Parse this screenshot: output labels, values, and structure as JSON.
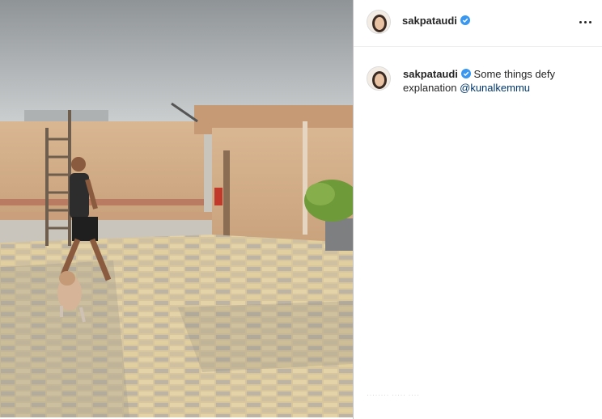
{
  "post": {
    "author": {
      "username": "sakpataudi",
      "verified": true,
      "avatar_icon": "profile-avatar"
    },
    "header": {
      "more_icon": "more-options-icon"
    },
    "caption": {
      "username": "sakpataudi",
      "text": "Some things defy explanation ",
      "mention": "@kunalkemmu"
    },
    "faded_footer": "········ ····· ····"
  },
  "colors": {
    "verified_badge": "#3897f0",
    "mention": "#00376b",
    "username": "#262626"
  }
}
